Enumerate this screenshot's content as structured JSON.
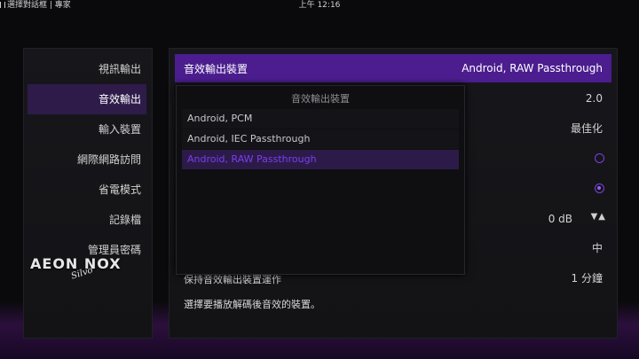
{
  "topbar": {
    "breadcrumb": "選擇對話框 | 專家",
    "time": "上午 12:16"
  },
  "sidebar": {
    "items": [
      {
        "label": "視訊輸出",
        "active": false
      },
      {
        "label": "音效輸出",
        "active": true
      },
      {
        "label": "輸入裝置",
        "active": false
      },
      {
        "label": "網際網路訪問",
        "active": false
      },
      {
        "label": "省電模式",
        "active": false
      },
      {
        "label": "記錄檔",
        "active": false
      },
      {
        "label": "管理員密碼",
        "active": false
      }
    ],
    "logo": {
      "main": "AEON NOX",
      "script": "Silvo"
    }
  },
  "settings": {
    "header": {
      "label": "音效輸出裝置",
      "value": "Android, RAW Passthrough"
    },
    "values": {
      "channels": "2.0",
      "mode": "最佳化",
      "volume": "0 dB",
      "level": "中",
      "keep_alive_value": "1 分鐘"
    },
    "keep_alive_label": "保持音效輸出裝置運作",
    "description": "選擇要播放解碼後音效的裝置。"
  },
  "dropdown": {
    "title": "音效輸出裝置",
    "options": [
      "Android, PCM",
      "Android, IEC Passthrough",
      "Android, RAW Passthrough"
    ],
    "selected_index": 2
  },
  "colors": {
    "accent": "#4b1d8f",
    "active_menu": "#2e1b4a",
    "selected_text": "#7b3df0"
  }
}
